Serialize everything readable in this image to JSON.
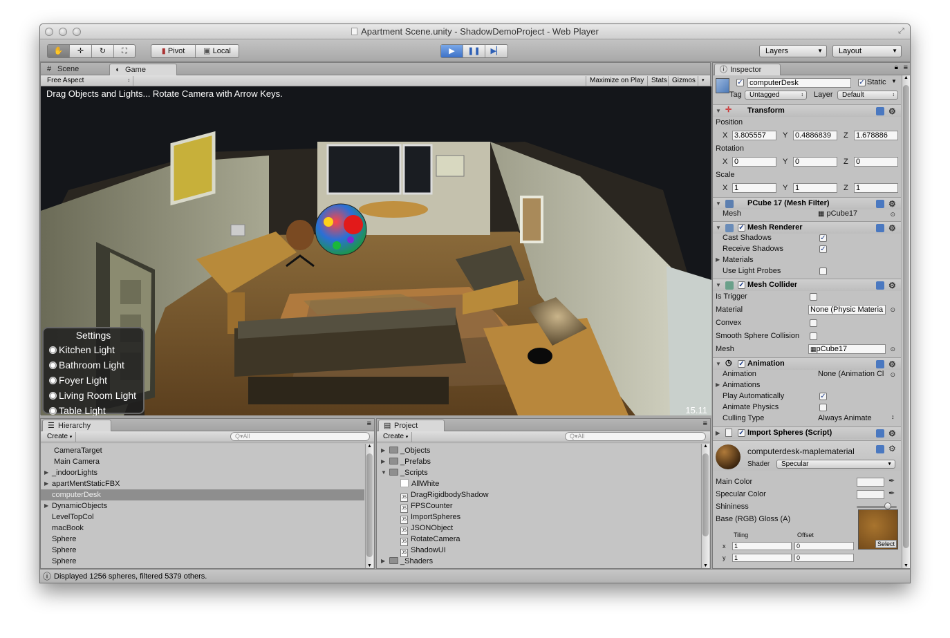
{
  "window": {
    "title": "Apartment Scene.unity - ShadowDemoProject - Web Player"
  },
  "toolbar": {
    "pivot_label": "Pivot",
    "local_label": "Local",
    "layers_label": "Layers",
    "layout_label": "Layout"
  },
  "scene_panel": {
    "tab_scene": "Scene",
    "tab_game": "Game",
    "aspect": "Free Aspect",
    "maximize_label": "Maximize on Play",
    "stats_label": "Stats",
    "gizmos_label": "Gizmos",
    "hint": "Drag Objects and Lights... Rotate Camera with Arrow Keys.",
    "fps": "15.11",
    "settings": {
      "title": "Settings",
      "options": [
        "Kitchen Light",
        "Bathroom Light",
        "Foyer Light",
        "Living Room Light",
        "Table Light"
      ]
    }
  },
  "hierarchy": {
    "tab": "Hierarchy",
    "create_label": "Create",
    "search_placeholder": "Q▾All",
    "items": [
      {
        "label": "CameraTarget",
        "expandable": false
      },
      {
        "label": "Main Camera",
        "expandable": false
      },
      {
        "label": "_indoorLights",
        "expandable": true
      },
      {
        "label": "apartMentStaticFBX",
        "expandable": true
      },
      {
        "label": "computerDesk",
        "expandable": false,
        "selected": true
      },
      {
        "label": "DynamicObjects",
        "expandable": true
      },
      {
        "label": "LevelTopCol",
        "expandable": false
      },
      {
        "label": "macBook",
        "expandable": false
      },
      {
        "label": "Sphere",
        "expandable": false
      },
      {
        "label": "Sphere",
        "expandable": false
      },
      {
        "label": "Sphere",
        "expandable": false
      }
    ]
  },
  "project": {
    "tab": "Project",
    "create_label": "Create",
    "search_placeholder": "Q▾All",
    "items": [
      {
        "label": "_Objects",
        "type": "folder",
        "depth": 0,
        "caret": "right"
      },
      {
        "label": "_Prefabs",
        "type": "folder",
        "depth": 0,
        "caret": "right"
      },
      {
        "label": "_Scripts",
        "type": "folder",
        "depth": 0,
        "caret": "down"
      },
      {
        "label": "AllWhite",
        "type": "material",
        "depth": 1
      },
      {
        "label": "DragRigidbodyShadow",
        "type": "script",
        "depth": 1
      },
      {
        "label": "FPSCounter",
        "type": "script",
        "depth": 1
      },
      {
        "label": "ImportSpheres",
        "type": "script",
        "depth": 1
      },
      {
        "label": "JSONObject",
        "type": "script",
        "depth": 1
      },
      {
        "label": "RotateCamera",
        "type": "script",
        "depth": 1
      },
      {
        "label": "ShadowUI",
        "type": "script",
        "depth": 1
      },
      {
        "label": "_Shaders",
        "type": "folder",
        "depth": 0,
        "caret": "right"
      }
    ]
  },
  "inspector": {
    "tab": "Inspector",
    "object_name": "computerDesk",
    "static_label": "Static",
    "tag_label": "Tag",
    "tag_value": "Untagged",
    "layer_label": "Layer",
    "layer_value": "Default",
    "transform": {
      "title": "Transform",
      "position_label": "Position",
      "rotation_label": "Rotation",
      "scale_label": "Scale",
      "axis_x": "X",
      "axis_y": "Y",
      "axis_z": "Z",
      "position": [
        "3.805557",
        "0.4886839",
        "1.678886"
      ],
      "rotation": [
        "0",
        "0",
        "0"
      ],
      "scale": [
        "1",
        "1",
        "1"
      ]
    },
    "mesh_filter": {
      "title": "PCube 17 (Mesh Filter)",
      "mesh_label": "Mesh",
      "mesh_value": "pCube17"
    },
    "mesh_renderer": {
      "title": "Mesh Renderer",
      "cast_shadows": "Cast Shadows",
      "receive_shadows": "Receive Shadows",
      "materials": "Materials",
      "use_light_probes": "Use Light Probes"
    },
    "mesh_collider": {
      "title": "Mesh Collider",
      "is_trigger": "Is Trigger",
      "material_label": "Material",
      "material_value": "None (Physic Materia",
      "convex": "Convex",
      "smooth": "Smooth Sphere Collision",
      "mesh_label": "Mesh",
      "mesh_value": "pCube17"
    },
    "animation": {
      "title": "Animation",
      "animation_label": "Animation",
      "animation_value": "None (Animation Cl",
      "animations": "Animations",
      "play_auto": "Play Automatically",
      "animate_physics": "Animate Physics",
      "culling_label": "Culling Type",
      "culling_value": "Always Animate"
    },
    "import_spheres": {
      "title": "Import Spheres (Script)"
    },
    "material": {
      "name": "computerdesk-maplematerial",
      "shader_label": "Shader",
      "shader_value": "Specular",
      "main_color": "Main Color",
      "specular_color": "Specular Color",
      "shininess": "Shininess",
      "shininess_value": 0.78,
      "base_label": "Base (RGB) Gloss (A)",
      "tiling": "Tiling",
      "offset": "Offset",
      "x_label": "x",
      "y_label": "y",
      "tiling_x": "1",
      "tiling_y": "1",
      "offset_x": "0",
      "offset_y": "0",
      "select_label": "Select"
    }
  },
  "status": {
    "text": "Displayed 1256 spheres, filtered 5379 others."
  }
}
